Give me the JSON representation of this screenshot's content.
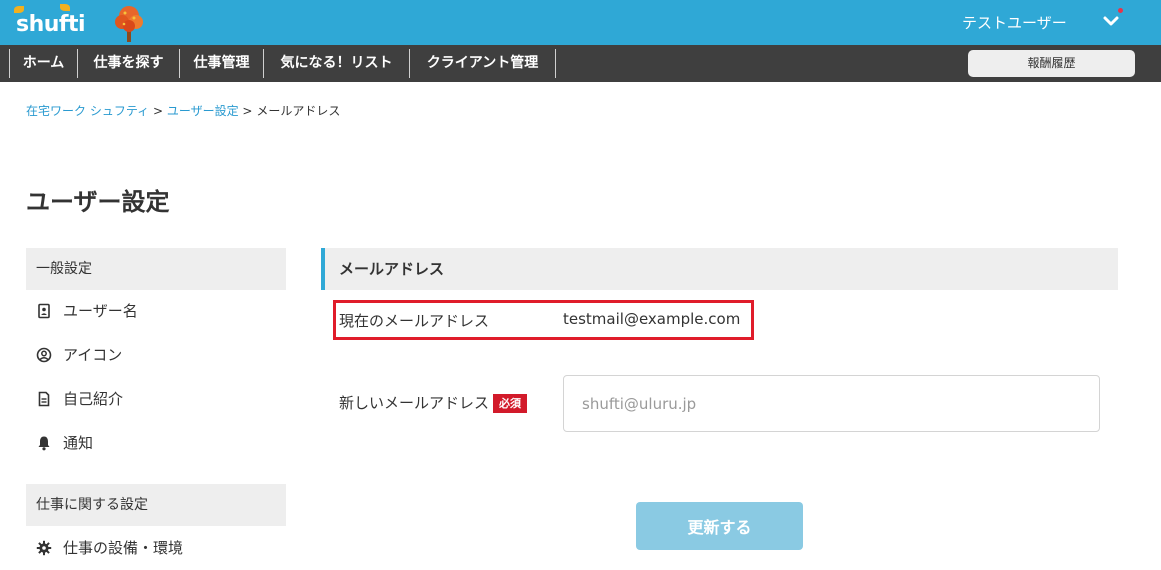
{
  "header": {
    "logo_text": "shufti",
    "user_name": "テストユーザー",
    "icons": {
      "user_menu": "chevron-down-icon",
      "notification": "notification-dot"
    },
    "colors": {
      "topbar": "#2fa8d6",
      "navbar": "#3f3f3f",
      "accent": "#2fa8d6",
      "required": "#d21a2a",
      "highlight": "#e01c2a"
    }
  },
  "nav": {
    "items": [
      {
        "label": "ホーム"
      },
      {
        "label": "仕事を探す"
      },
      {
        "label": "仕事管理"
      },
      {
        "label": "気になる！リスト"
      },
      {
        "label": "クライアント管理"
      }
    ],
    "reward_button": "報酬履歴"
  },
  "breadcrumb": {
    "items": [
      "在宅ワーク シュフティ",
      "ユーザー設定",
      "メールアドレス"
    ],
    "separator": ">"
  },
  "page_title": "ユーザー設定",
  "sidebar": {
    "general_header": "一般設定",
    "general_items": [
      {
        "label": "ユーザー名",
        "icon": "id-card-icon"
      },
      {
        "label": "アイコン",
        "icon": "user-circle-icon"
      },
      {
        "label": "自己紹介",
        "icon": "document-icon"
      },
      {
        "label": "通知",
        "icon": "bell-icon"
      }
    ],
    "work_header": "仕事に関する設定",
    "work_items": [
      {
        "label": "仕事の設備・環境",
        "icon": "gear-icon"
      }
    ]
  },
  "main": {
    "section_title": "メールアドレス",
    "current_label": "現在のメールアドレス",
    "current_value": "testmail@example.com",
    "new_label": "新しいメールアドレス",
    "required_badge": "必須",
    "new_placeholder": "shufti@uluru.jp",
    "new_value": "",
    "submit_label": "更新する"
  }
}
